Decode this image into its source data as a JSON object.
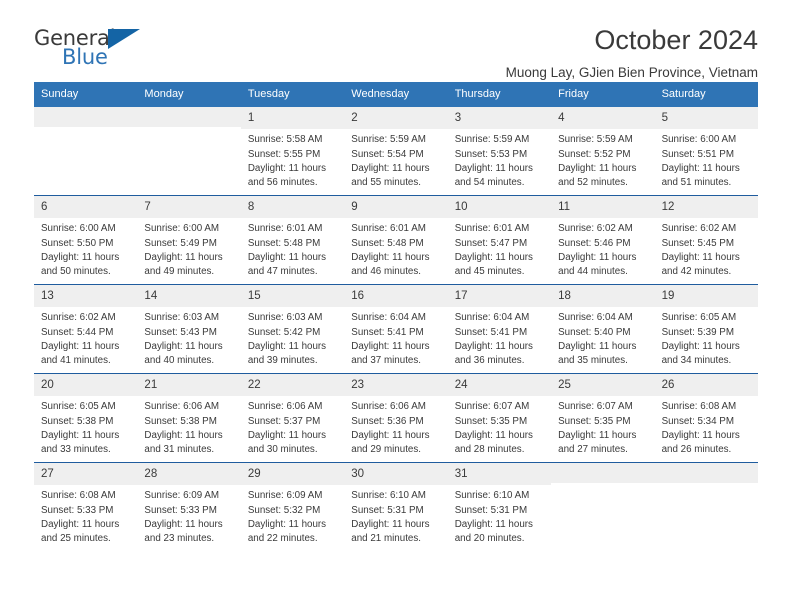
{
  "brand": {
    "name_top": "General",
    "name_bottom": "Blue",
    "accent_color": "#2f74b5"
  },
  "header": {
    "title": "October 2024",
    "subtitle": "Muong Lay, GJien Bien Province, Vietnam"
  },
  "calendar": {
    "weekdays": [
      "Sunday",
      "Monday",
      "Tuesday",
      "Wednesday",
      "Thursday",
      "Friday",
      "Saturday"
    ],
    "header_bg": "#2f74b5",
    "day_band_bg": "#efefef",
    "row_divider": "#1f5c9e",
    "weeks": [
      [
        {
          "day": "",
          "sunrise": "",
          "sunset": "",
          "daylight_1": "",
          "daylight_2": ""
        },
        {
          "day": "",
          "sunrise": "",
          "sunset": "",
          "daylight_1": "",
          "daylight_2": ""
        },
        {
          "day": "1",
          "sunrise": "Sunrise: 5:58 AM",
          "sunset": "Sunset: 5:55 PM",
          "daylight_1": "Daylight: 11 hours",
          "daylight_2": "and 56 minutes."
        },
        {
          "day": "2",
          "sunrise": "Sunrise: 5:59 AM",
          "sunset": "Sunset: 5:54 PM",
          "daylight_1": "Daylight: 11 hours",
          "daylight_2": "and 55 minutes."
        },
        {
          "day": "3",
          "sunrise": "Sunrise: 5:59 AM",
          "sunset": "Sunset: 5:53 PM",
          "daylight_1": "Daylight: 11 hours",
          "daylight_2": "and 54 minutes."
        },
        {
          "day": "4",
          "sunrise": "Sunrise: 5:59 AM",
          "sunset": "Sunset: 5:52 PM",
          "daylight_1": "Daylight: 11 hours",
          "daylight_2": "and 52 minutes."
        },
        {
          "day": "5",
          "sunrise": "Sunrise: 6:00 AM",
          "sunset": "Sunset: 5:51 PM",
          "daylight_1": "Daylight: 11 hours",
          "daylight_2": "and 51 minutes."
        }
      ],
      [
        {
          "day": "6",
          "sunrise": "Sunrise: 6:00 AM",
          "sunset": "Sunset: 5:50 PM",
          "daylight_1": "Daylight: 11 hours",
          "daylight_2": "and 50 minutes."
        },
        {
          "day": "7",
          "sunrise": "Sunrise: 6:00 AM",
          "sunset": "Sunset: 5:49 PM",
          "daylight_1": "Daylight: 11 hours",
          "daylight_2": "and 49 minutes."
        },
        {
          "day": "8",
          "sunrise": "Sunrise: 6:01 AM",
          "sunset": "Sunset: 5:48 PM",
          "daylight_1": "Daylight: 11 hours",
          "daylight_2": "and 47 minutes."
        },
        {
          "day": "9",
          "sunrise": "Sunrise: 6:01 AM",
          "sunset": "Sunset: 5:48 PM",
          "daylight_1": "Daylight: 11 hours",
          "daylight_2": "and 46 minutes."
        },
        {
          "day": "10",
          "sunrise": "Sunrise: 6:01 AM",
          "sunset": "Sunset: 5:47 PM",
          "daylight_1": "Daylight: 11 hours",
          "daylight_2": "and 45 minutes."
        },
        {
          "day": "11",
          "sunrise": "Sunrise: 6:02 AM",
          "sunset": "Sunset: 5:46 PM",
          "daylight_1": "Daylight: 11 hours",
          "daylight_2": "and 44 minutes."
        },
        {
          "day": "12",
          "sunrise": "Sunrise: 6:02 AM",
          "sunset": "Sunset: 5:45 PM",
          "daylight_1": "Daylight: 11 hours",
          "daylight_2": "and 42 minutes."
        }
      ],
      [
        {
          "day": "13",
          "sunrise": "Sunrise: 6:02 AM",
          "sunset": "Sunset: 5:44 PM",
          "daylight_1": "Daylight: 11 hours",
          "daylight_2": "and 41 minutes."
        },
        {
          "day": "14",
          "sunrise": "Sunrise: 6:03 AM",
          "sunset": "Sunset: 5:43 PM",
          "daylight_1": "Daylight: 11 hours",
          "daylight_2": "and 40 minutes."
        },
        {
          "day": "15",
          "sunrise": "Sunrise: 6:03 AM",
          "sunset": "Sunset: 5:42 PM",
          "daylight_1": "Daylight: 11 hours",
          "daylight_2": "and 39 minutes."
        },
        {
          "day": "16",
          "sunrise": "Sunrise: 6:04 AM",
          "sunset": "Sunset: 5:41 PM",
          "daylight_1": "Daylight: 11 hours",
          "daylight_2": "and 37 minutes."
        },
        {
          "day": "17",
          "sunrise": "Sunrise: 6:04 AM",
          "sunset": "Sunset: 5:41 PM",
          "daylight_1": "Daylight: 11 hours",
          "daylight_2": "and 36 minutes."
        },
        {
          "day": "18",
          "sunrise": "Sunrise: 6:04 AM",
          "sunset": "Sunset: 5:40 PM",
          "daylight_1": "Daylight: 11 hours",
          "daylight_2": "and 35 minutes."
        },
        {
          "day": "19",
          "sunrise": "Sunrise: 6:05 AM",
          "sunset": "Sunset: 5:39 PM",
          "daylight_1": "Daylight: 11 hours",
          "daylight_2": "and 34 minutes."
        }
      ],
      [
        {
          "day": "20",
          "sunrise": "Sunrise: 6:05 AM",
          "sunset": "Sunset: 5:38 PM",
          "daylight_1": "Daylight: 11 hours",
          "daylight_2": "and 33 minutes."
        },
        {
          "day": "21",
          "sunrise": "Sunrise: 6:06 AM",
          "sunset": "Sunset: 5:38 PM",
          "daylight_1": "Daylight: 11 hours",
          "daylight_2": "and 31 minutes."
        },
        {
          "day": "22",
          "sunrise": "Sunrise: 6:06 AM",
          "sunset": "Sunset: 5:37 PM",
          "daylight_1": "Daylight: 11 hours",
          "daylight_2": "and 30 minutes."
        },
        {
          "day": "23",
          "sunrise": "Sunrise: 6:06 AM",
          "sunset": "Sunset: 5:36 PM",
          "daylight_1": "Daylight: 11 hours",
          "daylight_2": "and 29 minutes."
        },
        {
          "day": "24",
          "sunrise": "Sunrise: 6:07 AM",
          "sunset": "Sunset: 5:35 PM",
          "daylight_1": "Daylight: 11 hours",
          "daylight_2": "and 28 minutes."
        },
        {
          "day": "25",
          "sunrise": "Sunrise: 6:07 AM",
          "sunset": "Sunset: 5:35 PM",
          "daylight_1": "Daylight: 11 hours",
          "daylight_2": "and 27 minutes."
        },
        {
          "day": "26",
          "sunrise": "Sunrise: 6:08 AM",
          "sunset": "Sunset: 5:34 PM",
          "daylight_1": "Daylight: 11 hours",
          "daylight_2": "and 26 minutes."
        }
      ],
      [
        {
          "day": "27",
          "sunrise": "Sunrise: 6:08 AM",
          "sunset": "Sunset: 5:33 PM",
          "daylight_1": "Daylight: 11 hours",
          "daylight_2": "and 25 minutes."
        },
        {
          "day": "28",
          "sunrise": "Sunrise: 6:09 AM",
          "sunset": "Sunset: 5:33 PM",
          "daylight_1": "Daylight: 11 hours",
          "daylight_2": "and 23 minutes."
        },
        {
          "day": "29",
          "sunrise": "Sunrise: 6:09 AM",
          "sunset": "Sunset: 5:32 PM",
          "daylight_1": "Daylight: 11 hours",
          "daylight_2": "and 22 minutes."
        },
        {
          "day": "30",
          "sunrise": "Sunrise: 6:10 AM",
          "sunset": "Sunset: 5:31 PM",
          "daylight_1": "Daylight: 11 hours",
          "daylight_2": "and 21 minutes."
        },
        {
          "day": "31",
          "sunrise": "Sunrise: 6:10 AM",
          "sunset": "Sunset: 5:31 PM",
          "daylight_1": "Daylight: 11 hours",
          "daylight_2": "and 20 minutes."
        },
        {
          "day": "",
          "sunrise": "",
          "sunset": "",
          "daylight_1": "",
          "daylight_2": ""
        },
        {
          "day": "",
          "sunrise": "",
          "sunset": "",
          "daylight_1": "",
          "daylight_2": ""
        }
      ]
    ]
  }
}
